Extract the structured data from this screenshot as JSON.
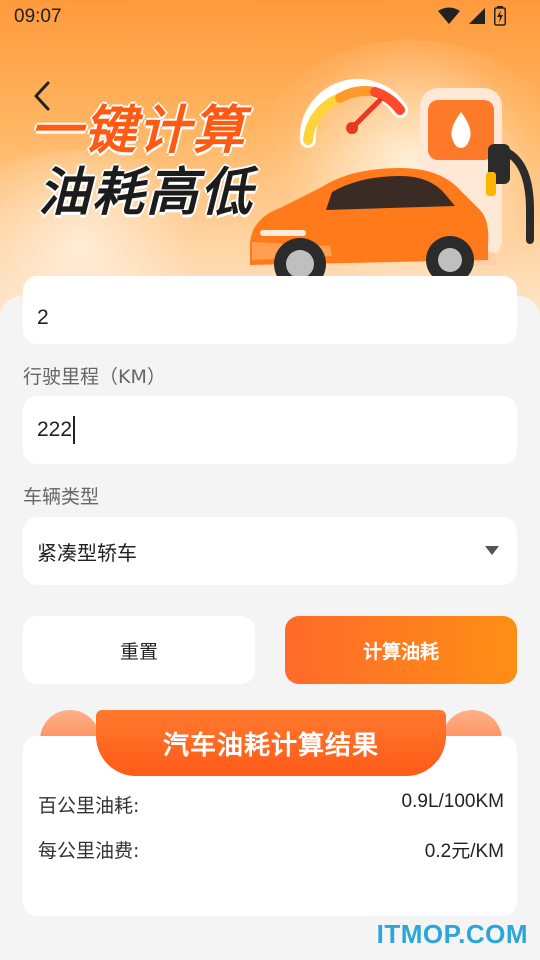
{
  "status_bar": {
    "time": "09:07"
  },
  "hero": {
    "title_line1": "一键计算",
    "title_line2": "油耗高低"
  },
  "form": {
    "fuel_value": "2",
    "mileage_label": "行驶里程（KM）",
    "mileage_value": "222",
    "vehicle_type_label": "车辆类型",
    "vehicle_type_value": "紧凑型轿车"
  },
  "actions": {
    "reset_label": "重置",
    "calculate_label": "计算油耗"
  },
  "result": {
    "title": "汽车油耗计算结果",
    "per100_label": "百公里油耗:",
    "per100_value": "0.9L/100KM",
    "perkm_cost_label": "每公里油费:",
    "perkm_cost_value": "0.2元/KM"
  },
  "watermark": "ITMOP.COM",
  "colors": {
    "accent": "#ff6a2b",
    "accent_end": "#ff8f14",
    "background": "#f4f4f4"
  }
}
